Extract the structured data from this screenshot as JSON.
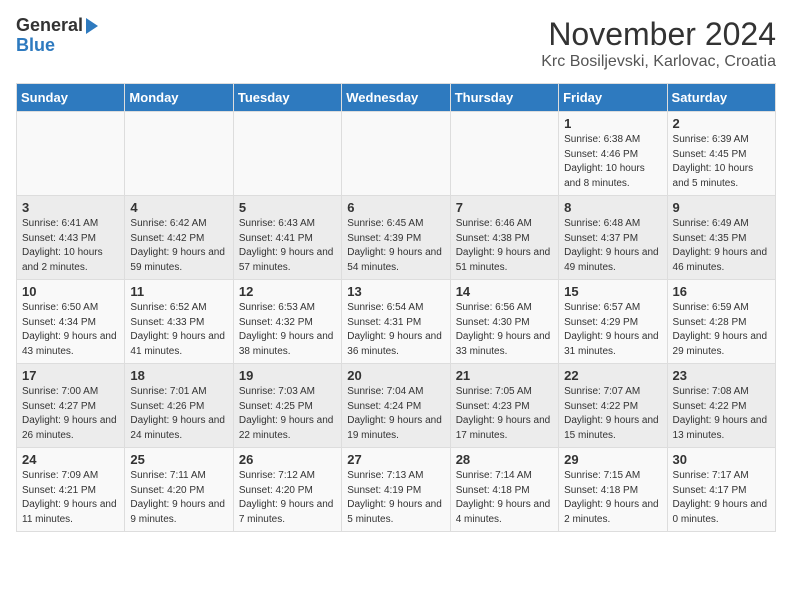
{
  "logo": {
    "general": "General",
    "blue": "Blue"
  },
  "header": {
    "month": "November 2024",
    "location": "Krc Bosiljevski, Karlovac, Croatia"
  },
  "days_of_week": [
    "Sunday",
    "Monday",
    "Tuesday",
    "Wednesday",
    "Thursday",
    "Friday",
    "Saturday"
  ],
  "weeks": [
    [
      {
        "num": "",
        "info": ""
      },
      {
        "num": "",
        "info": ""
      },
      {
        "num": "",
        "info": ""
      },
      {
        "num": "",
        "info": ""
      },
      {
        "num": "",
        "info": ""
      },
      {
        "num": "1",
        "info": "Sunrise: 6:38 AM\nSunset: 4:46 PM\nDaylight: 10 hours and 8 minutes."
      },
      {
        "num": "2",
        "info": "Sunrise: 6:39 AM\nSunset: 4:45 PM\nDaylight: 10 hours and 5 minutes."
      }
    ],
    [
      {
        "num": "3",
        "info": "Sunrise: 6:41 AM\nSunset: 4:43 PM\nDaylight: 10 hours and 2 minutes."
      },
      {
        "num": "4",
        "info": "Sunrise: 6:42 AM\nSunset: 4:42 PM\nDaylight: 9 hours and 59 minutes."
      },
      {
        "num": "5",
        "info": "Sunrise: 6:43 AM\nSunset: 4:41 PM\nDaylight: 9 hours and 57 minutes."
      },
      {
        "num": "6",
        "info": "Sunrise: 6:45 AM\nSunset: 4:39 PM\nDaylight: 9 hours and 54 minutes."
      },
      {
        "num": "7",
        "info": "Sunrise: 6:46 AM\nSunset: 4:38 PM\nDaylight: 9 hours and 51 minutes."
      },
      {
        "num": "8",
        "info": "Sunrise: 6:48 AM\nSunset: 4:37 PM\nDaylight: 9 hours and 49 minutes."
      },
      {
        "num": "9",
        "info": "Sunrise: 6:49 AM\nSunset: 4:35 PM\nDaylight: 9 hours and 46 minutes."
      }
    ],
    [
      {
        "num": "10",
        "info": "Sunrise: 6:50 AM\nSunset: 4:34 PM\nDaylight: 9 hours and 43 minutes."
      },
      {
        "num": "11",
        "info": "Sunrise: 6:52 AM\nSunset: 4:33 PM\nDaylight: 9 hours and 41 minutes."
      },
      {
        "num": "12",
        "info": "Sunrise: 6:53 AM\nSunset: 4:32 PM\nDaylight: 9 hours and 38 minutes."
      },
      {
        "num": "13",
        "info": "Sunrise: 6:54 AM\nSunset: 4:31 PM\nDaylight: 9 hours and 36 minutes."
      },
      {
        "num": "14",
        "info": "Sunrise: 6:56 AM\nSunset: 4:30 PM\nDaylight: 9 hours and 33 minutes."
      },
      {
        "num": "15",
        "info": "Sunrise: 6:57 AM\nSunset: 4:29 PM\nDaylight: 9 hours and 31 minutes."
      },
      {
        "num": "16",
        "info": "Sunrise: 6:59 AM\nSunset: 4:28 PM\nDaylight: 9 hours and 29 minutes."
      }
    ],
    [
      {
        "num": "17",
        "info": "Sunrise: 7:00 AM\nSunset: 4:27 PM\nDaylight: 9 hours and 26 minutes."
      },
      {
        "num": "18",
        "info": "Sunrise: 7:01 AM\nSunset: 4:26 PM\nDaylight: 9 hours and 24 minutes."
      },
      {
        "num": "19",
        "info": "Sunrise: 7:03 AM\nSunset: 4:25 PM\nDaylight: 9 hours and 22 minutes."
      },
      {
        "num": "20",
        "info": "Sunrise: 7:04 AM\nSunset: 4:24 PM\nDaylight: 9 hours and 19 minutes."
      },
      {
        "num": "21",
        "info": "Sunrise: 7:05 AM\nSunset: 4:23 PM\nDaylight: 9 hours and 17 minutes."
      },
      {
        "num": "22",
        "info": "Sunrise: 7:07 AM\nSunset: 4:22 PM\nDaylight: 9 hours and 15 minutes."
      },
      {
        "num": "23",
        "info": "Sunrise: 7:08 AM\nSunset: 4:22 PM\nDaylight: 9 hours and 13 minutes."
      }
    ],
    [
      {
        "num": "24",
        "info": "Sunrise: 7:09 AM\nSunset: 4:21 PM\nDaylight: 9 hours and 11 minutes."
      },
      {
        "num": "25",
        "info": "Sunrise: 7:11 AM\nSunset: 4:20 PM\nDaylight: 9 hours and 9 minutes."
      },
      {
        "num": "26",
        "info": "Sunrise: 7:12 AM\nSunset: 4:20 PM\nDaylight: 9 hours and 7 minutes."
      },
      {
        "num": "27",
        "info": "Sunrise: 7:13 AM\nSunset: 4:19 PM\nDaylight: 9 hours and 5 minutes."
      },
      {
        "num": "28",
        "info": "Sunrise: 7:14 AM\nSunset: 4:18 PM\nDaylight: 9 hours and 4 minutes."
      },
      {
        "num": "29",
        "info": "Sunrise: 7:15 AM\nSunset: 4:18 PM\nDaylight: 9 hours and 2 minutes."
      },
      {
        "num": "30",
        "info": "Sunrise: 7:17 AM\nSunset: 4:17 PM\nDaylight: 9 hours and 0 minutes."
      }
    ]
  ]
}
